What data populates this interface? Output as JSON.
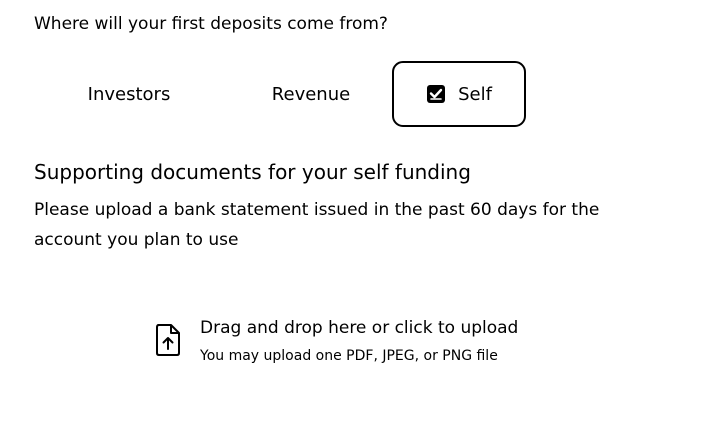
{
  "question": "Where will your first deposits come from?",
  "options": [
    {
      "label": "Investors",
      "selected": false
    },
    {
      "label": "Revenue",
      "selected": false
    },
    {
      "label": "Self",
      "selected": true
    }
  ],
  "section": {
    "title": "Supporting documents for your self funding",
    "description": "Please upload a bank statement issued in the past 60 days for the account you plan to use"
  },
  "upload": {
    "title": "Drag and drop here or click to upload",
    "subtitle": "You may upload one PDF, JPEG, or PNG file",
    "icon": "file-upload-icon"
  },
  "colors": {
    "text": "#000000",
    "background": "#ffffff",
    "selected_border": "#000000"
  }
}
